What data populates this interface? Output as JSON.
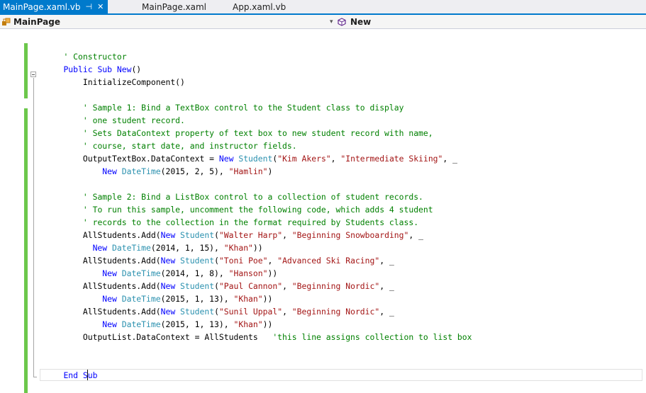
{
  "tabs": [
    {
      "label": "MainPage.xaml.vb",
      "active": true
    },
    {
      "label": "MainPage.xaml",
      "active": false
    },
    {
      "label": "App.xaml.vb",
      "active": false
    }
  ],
  "navbar": {
    "class_name": "MainPage",
    "member_name": "New"
  },
  "colors": {
    "accent": "#007acc",
    "keyword": "#0000ff",
    "type": "#2b91af",
    "string": "#a31515",
    "comment": "#008000",
    "changed_margin": "#6cc74b"
  },
  "code_lines": [
    {
      "indent": 0,
      "tokens": []
    },
    {
      "indent": 1,
      "tokens": [
        {
          "t": "cm",
          "v": "' Constructor"
        }
      ]
    },
    {
      "indent": 1,
      "tokens": [
        {
          "t": "kw",
          "v": "Public Sub New"
        },
        {
          "t": "id",
          "v": "()"
        }
      ]
    },
    {
      "indent": 2,
      "tokens": [
        {
          "t": "id",
          "v": "InitializeComponent()"
        }
      ]
    },
    {
      "indent": 0,
      "tokens": []
    },
    {
      "indent": 2,
      "tokens": [
        {
          "t": "cm",
          "v": "' Sample 1: Bind a TextBox control to the Student class to display"
        }
      ]
    },
    {
      "indent": 2,
      "tokens": [
        {
          "t": "cm",
          "v": "' one student record."
        }
      ]
    },
    {
      "indent": 2,
      "tokens": [
        {
          "t": "cm",
          "v": "' Sets DataContext property of text box to new student record with name,"
        }
      ]
    },
    {
      "indent": 2,
      "tokens": [
        {
          "t": "cm",
          "v": "' course, start date, and instructor fields."
        }
      ]
    },
    {
      "indent": 2,
      "tokens": [
        {
          "t": "id",
          "v": "OutputTextBox.DataContext = "
        },
        {
          "t": "kw",
          "v": "New "
        },
        {
          "t": "type",
          "v": "Student"
        },
        {
          "t": "id",
          "v": "("
        },
        {
          "t": "str",
          "v": "\"Kim Akers\""
        },
        {
          "t": "id",
          "v": ", "
        },
        {
          "t": "str",
          "v": "\"Intermediate Skiing\""
        },
        {
          "t": "id",
          "v": ", _"
        }
      ]
    },
    {
      "indent": 3,
      "tokens": [
        {
          "t": "kw",
          "v": "New "
        },
        {
          "t": "type",
          "v": "DateTime"
        },
        {
          "t": "id",
          "v": "(2015, 2, 5), "
        },
        {
          "t": "str",
          "v": "\"Hamlin\""
        },
        {
          "t": "id",
          "v": ")"
        }
      ]
    },
    {
      "indent": 0,
      "tokens": []
    },
    {
      "indent": 2,
      "tokens": [
        {
          "t": "cm",
          "v": "' Sample 2: Bind a ListBox control to a collection of student records."
        }
      ]
    },
    {
      "indent": 2,
      "tokens": [
        {
          "t": "cm",
          "v": "' To run this sample, uncomment the following code, which adds 4 student"
        }
      ]
    },
    {
      "indent": 2,
      "tokens": [
        {
          "t": "cm",
          "v": "' records to the collection in the format required by Students class."
        }
      ]
    },
    {
      "indent": 2,
      "tokens": [
        {
          "t": "id",
          "v": "AllStudents.Add("
        },
        {
          "t": "kw",
          "v": "New "
        },
        {
          "t": "type",
          "v": "Student"
        },
        {
          "t": "id",
          "v": "("
        },
        {
          "t": "str",
          "v": "\"Walter Harp\""
        },
        {
          "t": "id",
          "v": ", "
        },
        {
          "t": "str",
          "v": "\"Beginning Snowboarding\""
        },
        {
          "t": "id",
          "v": ", _"
        }
      ]
    },
    {
      "indent": 2,
      "pad": "  ",
      "tokens": [
        {
          "t": "kw",
          "v": "New "
        },
        {
          "t": "type",
          "v": "DateTime"
        },
        {
          "t": "id",
          "v": "(2014, 1, 15), "
        },
        {
          "t": "str",
          "v": "\"Khan\""
        },
        {
          "t": "id",
          "v": "))"
        }
      ]
    },
    {
      "indent": 2,
      "tokens": [
        {
          "t": "id",
          "v": "AllStudents.Add("
        },
        {
          "t": "kw",
          "v": "New "
        },
        {
          "t": "type",
          "v": "Student"
        },
        {
          "t": "id",
          "v": "("
        },
        {
          "t": "str",
          "v": "\"Toni Poe\""
        },
        {
          "t": "id",
          "v": ", "
        },
        {
          "t": "str",
          "v": "\"Advanced Ski Racing\""
        },
        {
          "t": "id",
          "v": ", _"
        }
      ]
    },
    {
      "indent": 3,
      "tokens": [
        {
          "t": "kw",
          "v": "New "
        },
        {
          "t": "type",
          "v": "DateTime"
        },
        {
          "t": "id",
          "v": "(2014, 1, 8), "
        },
        {
          "t": "str",
          "v": "\"Hanson\""
        },
        {
          "t": "id",
          "v": "))"
        }
      ]
    },
    {
      "indent": 2,
      "tokens": [
        {
          "t": "id",
          "v": "AllStudents.Add("
        },
        {
          "t": "kw",
          "v": "New "
        },
        {
          "t": "type",
          "v": "Student"
        },
        {
          "t": "id",
          "v": "("
        },
        {
          "t": "str",
          "v": "\"Paul Cannon\""
        },
        {
          "t": "id",
          "v": ", "
        },
        {
          "t": "str",
          "v": "\"Beginning Nordic\""
        },
        {
          "t": "id",
          "v": ", _"
        }
      ]
    },
    {
      "indent": 3,
      "tokens": [
        {
          "t": "kw",
          "v": "New "
        },
        {
          "t": "type",
          "v": "DateTime"
        },
        {
          "t": "id",
          "v": "(2015, 1, 13), "
        },
        {
          "t": "str",
          "v": "\"Khan\""
        },
        {
          "t": "id",
          "v": "))"
        }
      ]
    },
    {
      "indent": 2,
      "tokens": [
        {
          "t": "id",
          "v": "AllStudents.Add("
        },
        {
          "t": "kw",
          "v": "New "
        },
        {
          "t": "type",
          "v": "Student"
        },
        {
          "t": "id",
          "v": "("
        },
        {
          "t": "str",
          "v": "\"Sunil Uppal\""
        },
        {
          "t": "id",
          "v": ", "
        },
        {
          "t": "str",
          "v": "\"Beginning Nordic\""
        },
        {
          "t": "id",
          "v": ", _"
        }
      ]
    },
    {
      "indent": 3,
      "tokens": [
        {
          "t": "kw",
          "v": "New "
        },
        {
          "t": "type",
          "v": "DateTime"
        },
        {
          "t": "id",
          "v": "(2015, 1, 13), "
        },
        {
          "t": "str",
          "v": "\"Khan\""
        },
        {
          "t": "id",
          "v": "))"
        }
      ]
    },
    {
      "indent": 2,
      "tokens": [
        {
          "t": "id",
          "v": "OutputList.DataContext = AllStudents   "
        },
        {
          "t": "cm",
          "v": "'this line assigns collection to list box"
        }
      ]
    },
    {
      "indent": 0,
      "tokens": []
    },
    {
      "indent": 2,
      "tokens": []
    },
    {
      "indent": 1,
      "tokens": [
        {
          "t": "kw",
          "v": "End Sub"
        }
      ]
    }
  ]
}
